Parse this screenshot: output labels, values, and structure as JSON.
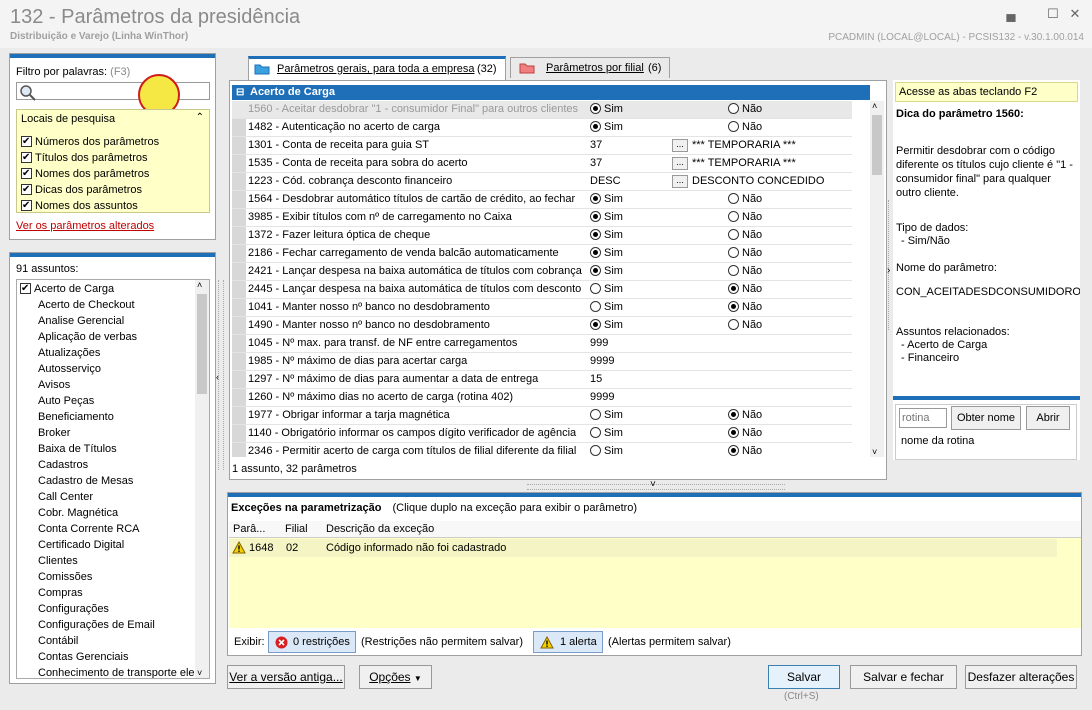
{
  "window": {
    "title": "132 - Parâmetros da presidência",
    "subtitle": "Distribuição e Varejo (Linha WinThor)",
    "status": "PCADMIN (LOCAL@LOCAL) - PCSIS132 - v.30.1.00.014"
  },
  "filter": {
    "label": "Filtro por palavras:",
    "shortcut": "(F3)",
    "search_value": "",
    "locais_title": "Locais de pesquisa",
    "options": [
      "Números dos parâmetros",
      "Títulos dos parâmetros",
      "Nomes dos parâmetros",
      "Dicas dos parâmetros",
      "Nomes dos assuntos"
    ],
    "changed_link": "Ver os parâmetros alterados"
  },
  "subjects": {
    "count_label": "91 assuntos:",
    "items": [
      "Acerto de Carga",
      "Acerto de Checkout",
      "Analise Gerencial",
      "Aplicação de verbas",
      "Atualizações",
      "Autosserviço",
      "Avisos",
      "Auto Peças",
      "Beneficiamento",
      "Broker",
      "Baixa de Títulos",
      "Cadastros",
      "Cadastro de Mesas",
      "Call Center",
      "Cobr. Magnética",
      "Conta Corrente RCA",
      "Certificado Digital",
      "Clientes",
      "Comissões",
      "Compras",
      "Configurações",
      "Configurações de Email",
      "Contábil",
      "Contas Gerenciais",
      "Conhecimento de transporte ele"
    ]
  },
  "tabs": [
    {
      "label": "Parâmetros gerais, para toda a empresa",
      "count": "(32)"
    },
    {
      "label": "Parâmetros por filial",
      "count": "(6)"
    }
  ],
  "params": {
    "group": "Acerto de Carga",
    "footer": "1 assunto, 32 parâmetros",
    "yes": "Sim",
    "no": "Não",
    "rows": [
      {
        "label": "1560 - Aceitar desdobrar \"1 - consumidor Final\" para outros clientes",
        "type": "radio",
        "value": "Sim"
      },
      {
        "label": "1482 - Autenticação no acerto de carga",
        "type": "radio",
        "value": "Sim"
      },
      {
        "label": "1301 - Conta de receita para guia ST",
        "type": "lookup",
        "value": "37",
        "desc": "*** TEMPORARIA ***"
      },
      {
        "label": "1535 - Conta de receita para sobra do acerto",
        "type": "lookup",
        "value": "37",
        "desc": "*** TEMPORARIA ***"
      },
      {
        "label": "1223 - Cód. cobrança desconto financeiro",
        "type": "lookup",
        "value": "DESC",
        "desc": "DESCONTO CONCEDIDO"
      },
      {
        "label": "1564 - Desdobrar automático títulos de cartão de crédito, ao fechar",
        "type": "radio",
        "value": "Sim"
      },
      {
        "label": "3985 - Exibir títulos com nº de carregamento no Caixa",
        "type": "radio",
        "value": "Sim"
      },
      {
        "label": "1372 - Fazer leitura óptica de cheque",
        "type": "radio",
        "value": "Sim"
      },
      {
        "label": "2186 - Fechar carregamento de venda balcão automaticamente",
        "type": "radio",
        "value": "Sim"
      },
      {
        "label": "2421 - Lançar despesa na baixa automática de títulos com cobrança",
        "type": "radio",
        "value": "Sim"
      },
      {
        "label": "2445 - Lançar despesa na baixa automática de títulos com desconto",
        "type": "radio",
        "value": "Não"
      },
      {
        "label": "1041 - Manter nosso nº banco no desdobramento",
        "type": "radio",
        "value": "Não"
      },
      {
        "label": "1490 - Manter nosso nº banco no desdobramento",
        "type": "radio",
        "value": "Sim"
      },
      {
        "label": "1045 - Nº max. para transf. de NF entre carregamentos",
        "type": "text",
        "value": "999"
      },
      {
        "label": "1985 - Nº máximo de dias para acertar carga",
        "type": "text",
        "value": "9999"
      },
      {
        "label": "1297 - Nº máximo de dias para aumentar a data de entrega",
        "type": "text",
        "value": "15"
      },
      {
        "label": "1260 - Nº máximo dias no acerto de carga (rotina 402)",
        "type": "text",
        "value": "9999"
      },
      {
        "label": "1977 - Obrigar informar a tarja magnética",
        "type": "radio",
        "value": "Não"
      },
      {
        "label": "1140 - Obrigatório informar os campos dígito verificador de agência",
        "type": "radio",
        "value": "Não"
      },
      {
        "label": "2346 - Permitir acerto de carga com títulos de filial diferente da filial",
        "type": "radio",
        "value": "Não"
      }
    ]
  },
  "tip": {
    "hint": "Acesse as abas teclando F2",
    "title": "Dica do parâmetro 1560:",
    "text": "Permitir desdobrar com o código diferente os títulos cujo cliente é \"1 - consumidor final\" para qualquer outro cliente.",
    "type_label": "Tipo de dados:",
    "type_value": "- Sim/Não",
    "name_label": "Nome do parâmetro:",
    "name_value": "CON_ACEITADESDCONSUMIDOROUT",
    "related_label": "Assuntos relacionados:",
    "related": [
      "- Acerto de Carga",
      "- Financeiro"
    ],
    "rotina_placeholder": "rotina",
    "obter": "Obter nome",
    "abrir": "Abrir",
    "rotina_name": "nome da rotina"
  },
  "exceptions": {
    "title": "Exceções na parametrização",
    "hint": "(Clique duplo na exceção para exibir o parâmetro)",
    "columns": [
      "Parâ...",
      "Filial",
      "Descrição da exceção"
    ],
    "rows": [
      {
        "param": "1648",
        "filial": "02",
        "desc": "Código informado não foi cadastrado"
      }
    ],
    "exibir": "Exibir:",
    "restr_btn": "0 restrições",
    "restr_note": "(Restrições não permitem salvar)",
    "alert_btn": "1 alerta",
    "alert_note": "(Alertas permitem salvar)"
  },
  "buttons": {
    "old_version": "Ver a versão antiga...",
    "options": "Opções",
    "save": "Salvar",
    "save_shortcut": "(Ctrl+S)",
    "save_close": "Salvar e fechar",
    "undo": "Desfazer alterações"
  }
}
